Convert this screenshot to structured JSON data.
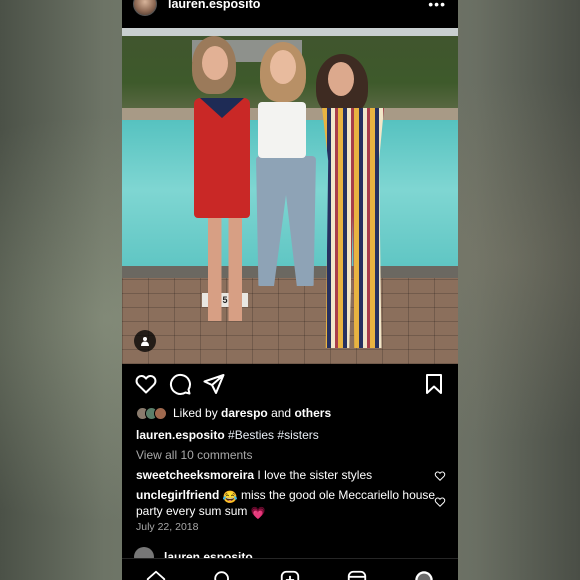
{
  "post": {
    "username": "lauren.esposito",
    "more_icon": "more-horizontal-icon",
    "photo": {
      "description_icon": "user-tag-icon",
      "pool_marker_text": "5"
    },
    "actions": {
      "like_icon": "heart-icon",
      "comment_icon": "comment-icon",
      "share_icon": "send-icon",
      "save_icon": "bookmark-icon"
    },
    "likes": {
      "prefix": "Liked by",
      "user": "darespo",
      "connector": "and",
      "others": "others"
    },
    "caption": {
      "username": "lauren.esposito",
      "text": "#Besties #sisters"
    },
    "view_comments": "View all 10 comments",
    "comments": [
      {
        "username": "sweetcheeksmoreira",
        "text": "I love the sister styles"
      },
      {
        "username": "unclegirlfriend",
        "emoji_1": "😂",
        "text": "miss the good ole Meccariello house party every sum sum",
        "emoji_2": "💗"
      }
    ],
    "date": "July 22, 2018",
    "next_post_username": "lauren.esposito"
  },
  "tabbar": {
    "icons": [
      "home-icon",
      "search-icon",
      "new-post-icon",
      "reels-icon",
      "profile-icon"
    ]
  },
  "colors": {
    "background": "#000000",
    "text": "#ffffff",
    "muted": "#a8a8a8"
  }
}
